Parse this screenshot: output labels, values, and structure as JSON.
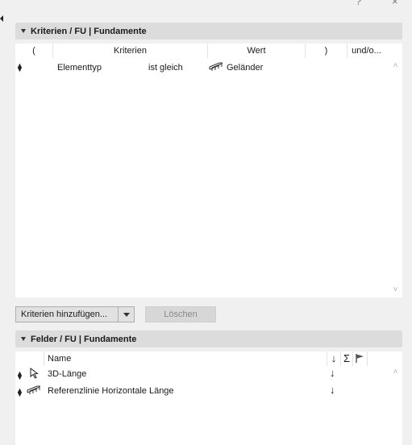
{
  "window": {
    "help_glyph": "?",
    "close_glyph": "×"
  },
  "criteria_section": {
    "title": "Kriterien / FU | Fundamente",
    "columns": [
      "(",
      "Kriterien",
      "Wert",
      ")",
      "und/o..."
    ],
    "rows": [
      {
        "paren_open": "",
        "criterion": "Elementtyp",
        "operator": "ist gleich",
        "value_icon": "railing-icon",
        "value": "Geländer",
        "paren_close": "",
        "conjunction": ""
      }
    ],
    "add_button_label": "Kriterien hinzufügen...",
    "delete_button_label": "Löschen"
  },
  "fields_section": {
    "title": "Felder / FU | Fundamente",
    "columns": {
      "name": "Name",
      "sort_glyph": "↓",
      "sum_glyph": "Σ",
      "flag_icon": "flag-icon"
    },
    "rows": [
      {
        "icon": "pointer-arrow-icon",
        "name": "3D-Länge",
        "sort": "↓"
      },
      {
        "icon": "railing-icon",
        "name": "Referenzlinie Horizontale Länge",
        "sort": "↓"
      }
    ]
  },
  "colors": {
    "background": "#f0f0f0",
    "section_header": "#dcdcdc",
    "panel": "#ffffff",
    "button_face": "#e1e1e1",
    "button_border": "#adadad",
    "disabled_text": "#8a8a8a"
  }
}
